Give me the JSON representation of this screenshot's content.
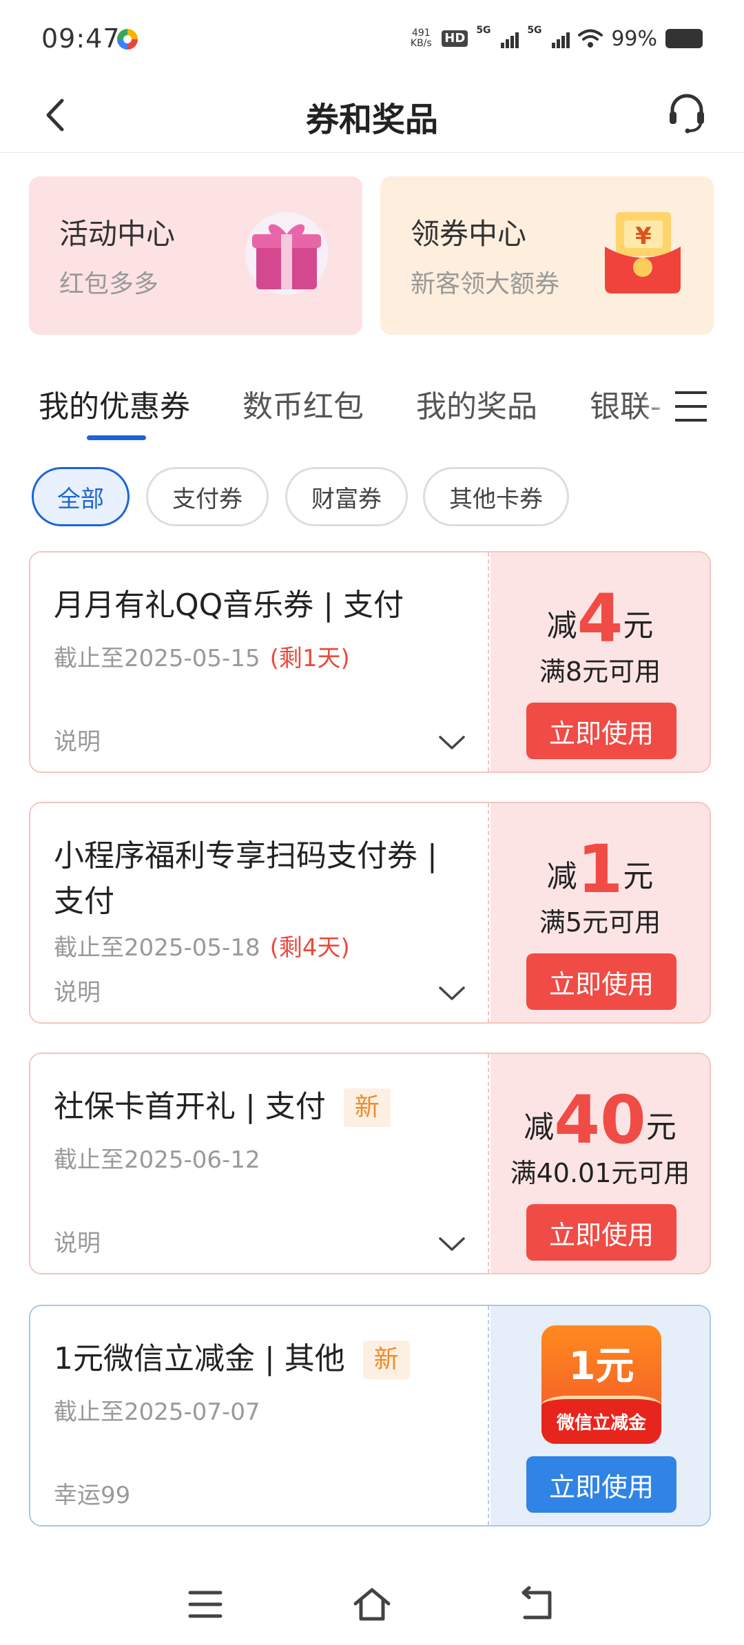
{
  "status_bar": {
    "time": "09:47",
    "net_speed_value": "491",
    "net_speed_unit": "KB/s",
    "hd_label": "HD",
    "network_1": "5G",
    "network_2": "5G",
    "battery": "99%"
  },
  "header": {
    "title": "券和奖品"
  },
  "banners": [
    {
      "title": "活动中心",
      "subtitle": "红包多多",
      "icon": "gift-icon"
    },
    {
      "title": "领券中心",
      "subtitle": "新客领大额券",
      "icon": "red-envelope-icon"
    }
  ],
  "tabs": [
    {
      "label": "我的优惠券",
      "active": true
    },
    {
      "label": "数币红包",
      "active": false
    },
    {
      "label": "我的奖品",
      "active": false
    },
    {
      "label": "银联-",
      "active": false
    }
  ],
  "filters": [
    {
      "label": "全部",
      "active": true
    },
    {
      "label": "支付券",
      "active": false
    },
    {
      "label": "财富券",
      "active": false
    },
    {
      "label": "其他卡券",
      "active": false
    }
  ],
  "coupons": [
    {
      "title": "月月有礼QQ音乐券 | 支付",
      "badge": "",
      "expire": "截止至2025-05-15",
      "remain": "(剩1天)",
      "note": "说明",
      "discount_prefix": "减",
      "amount": "4",
      "unit": "元",
      "condition": "满8元可用",
      "button": "立即使用"
    },
    {
      "title": "小程序福利专享扫码支付券 | 支付",
      "badge": "",
      "expire": "截止至2025-05-18",
      "remain": "(剩4天)",
      "note": "说明",
      "discount_prefix": "减",
      "amount": "1",
      "unit": "元",
      "condition": "满5元可用",
      "button": "立即使用"
    },
    {
      "title": "社保卡首开礼 | 支付",
      "badge": "新",
      "expire": "截止至2025-06-12",
      "remain": "",
      "note": "说明",
      "discount_prefix": "减",
      "amount": "40",
      "unit": "元",
      "condition": "满40.01元可用",
      "button": "立即使用"
    },
    {
      "title": "1元微信立减金 | 其他",
      "badge": "新",
      "expire": "截止至2025-07-07",
      "remain": "",
      "note": "幸运99",
      "badge_amount": "1元",
      "badge_label": "微信立减金",
      "button": "立即使用"
    }
  ],
  "colors": {
    "accent_blue": "#1c64d8",
    "coupon_red": "#f04b45",
    "button_blue": "#2f84e6",
    "new_badge_orange": "#f08a2c"
  }
}
